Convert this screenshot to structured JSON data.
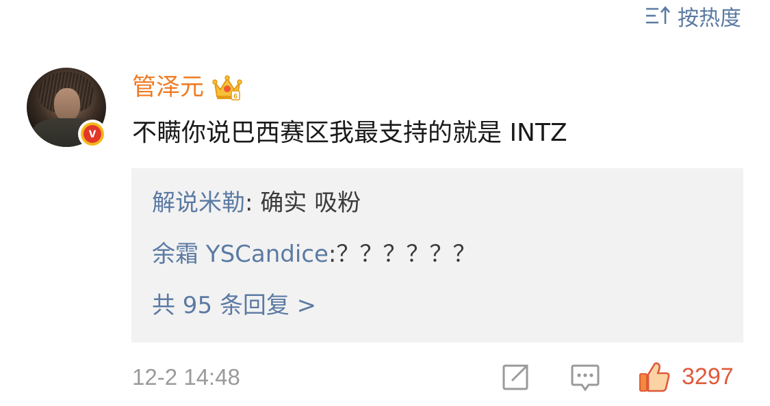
{
  "sort": {
    "label": "按热度",
    "icon": "sort-icon"
  },
  "comment": {
    "avatar_icon": "user-avatar",
    "verified_icon": "verified-v-badge",
    "username": "管泽元",
    "vip_icon": "vip-crown-icon",
    "text": "不瞒你说巴西赛区我最支持的就是 INTZ",
    "timestamp": "12-2 14:48",
    "like_count": "3297"
  },
  "replies": [
    {
      "author": "解说米勒",
      "text": ": 确实 吸粉"
    },
    {
      "author": "余霜 YSCandice",
      "text": ":？？？？？？"
    }
  ],
  "replies_more": "共 95 条回复 >",
  "actions": {
    "share_icon": "share-icon",
    "comment_icon": "comment-icon",
    "like_icon": "like-thumb-icon"
  },
  "colors": {
    "link_blue": "#5b7aa3",
    "username_orange": "#ef7b23",
    "like_orange": "#e0593a",
    "timestamp_gray": "#9a9a9a",
    "reply_bg": "#f2f2f2"
  }
}
